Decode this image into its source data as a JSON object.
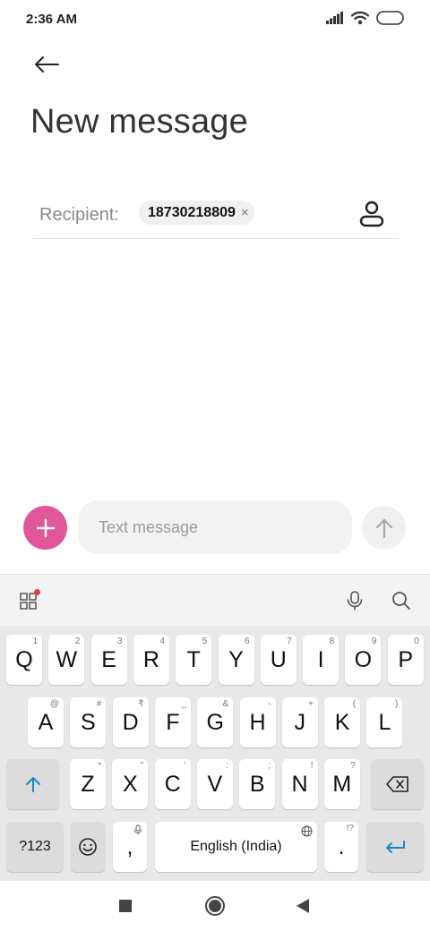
{
  "status_bar": {
    "time": "2:36 AM"
  },
  "header": {
    "title": "New message"
  },
  "recipient": {
    "label": "Recipient:",
    "chip": "18730218809",
    "chip_close": "×"
  },
  "composer": {
    "placeholder": "Text message"
  },
  "colors": {
    "accent": "#e0589a",
    "keyboard_accent": "#1a86c9"
  },
  "keyboard": {
    "row1": [
      {
        "k": "Q",
        "h": "1"
      },
      {
        "k": "W",
        "h": "2"
      },
      {
        "k": "E",
        "h": "3"
      },
      {
        "k": "R",
        "h": "4"
      },
      {
        "k": "T",
        "h": "5"
      },
      {
        "k": "Y",
        "h": "6"
      },
      {
        "k": "U",
        "h": "7"
      },
      {
        "k": "I",
        "h": "8"
      },
      {
        "k": "O",
        "h": "9"
      },
      {
        "k": "P",
        "h": "0"
      }
    ],
    "row2": [
      {
        "k": "A",
        "h": "@"
      },
      {
        "k": "S",
        "h": "#"
      },
      {
        "k": "D",
        "h": "₹"
      },
      {
        "k": "F",
        "h": "_"
      },
      {
        "k": "G",
        "h": "&"
      },
      {
        "k": "H",
        "h": "-"
      },
      {
        "k": "J",
        "h": "+"
      },
      {
        "k": "K",
        "h": "("
      },
      {
        "k": "L",
        "h": ")"
      }
    ],
    "row3": [
      {
        "k": "Z",
        "h": "*"
      },
      {
        "k": "X",
        "h": "\""
      },
      {
        "k": "C",
        "h": "'"
      },
      {
        "k": "V",
        "h": ":"
      },
      {
        "k": "B",
        "h": ";"
      },
      {
        "k": "N",
        "h": "!"
      },
      {
        "k": "M",
        "h": "?"
      }
    ],
    "num_label": "?123",
    "comma": ",",
    "space_label": "English (India)",
    "period": ".",
    "period_hint": "!?"
  }
}
